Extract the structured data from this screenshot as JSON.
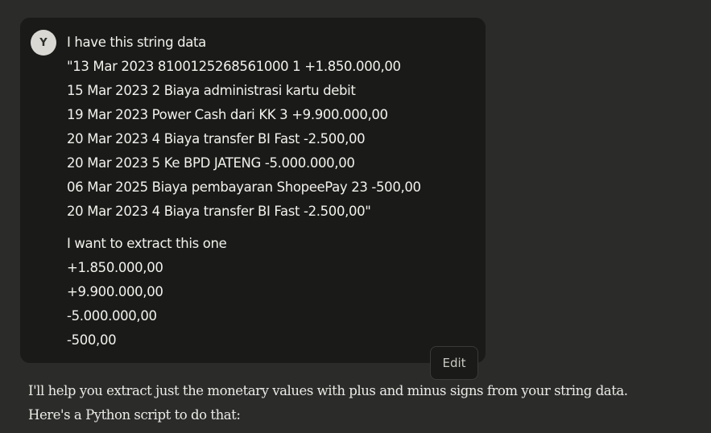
{
  "user_message": {
    "avatar_initial": "Y",
    "intro": "I have this string data",
    "data_lines": [
      "\"13 Mar 2023 8100125268561000 1 +1.850.000,00",
      "15 Mar 2023 2 Biaya administrasi kartu debit",
      "19 Mar 2023 Power Cash dari KK 3 +9.900.000,00",
      "20 Mar 2023 4 Biaya transfer BI Fast -2.500,00",
      "20 Mar 2023 5 Ke BPD JATENG -5.000.000,00",
      "06 Mar 2025 Biaya pembayaran ShopeePay 23 -500,00",
      "20 Mar 2023 4 Biaya transfer BI Fast -2.500,00\""
    ],
    "request": "I want to extract this one",
    "target_values": [
      "+1.850.000,00",
      "+9.900.000,00",
      "-5.000.000,00",
      "-500,00"
    ]
  },
  "edit_label": "Edit",
  "assistant_message": {
    "lines": [
      "I'll help you extract just the monetary values with plus and minus signs from your string data.",
      "Here's a Python script to do that:"
    ]
  },
  "colors": {
    "background": "#2b2b2a",
    "user_bubble": "#1a1a19",
    "avatar_bg": "#d9d8d2",
    "text_primary": "#f2f1ec"
  }
}
